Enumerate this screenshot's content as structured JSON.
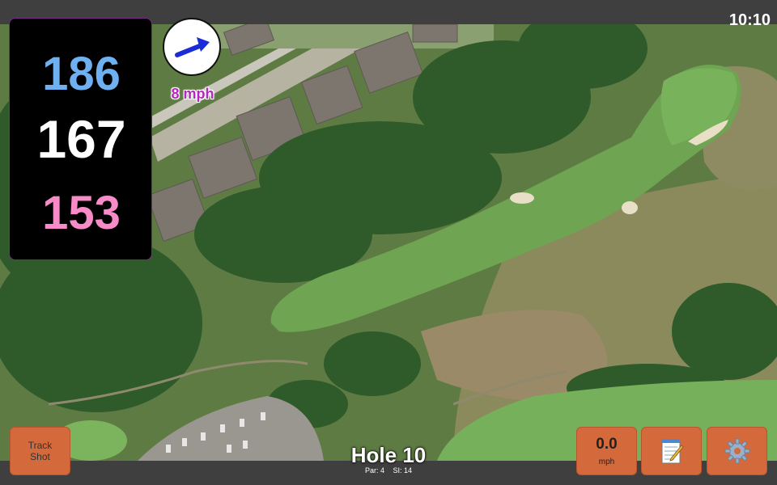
{
  "status": {
    "time": "10:10"
  },
  "distances": {
    "back": "186",
    "middle": "167",
    "front": "153"
  },
  "wind": {
    "speed_label": "8 mph",
    "icon": "wind-arrow-icon"
  },
  "hole": {
    "title": "Hole 10",
    "par_label": "Par: 4",
    "si_label": "SI: 14"
  },
  "buttons": {
    "track_shot_line1": "Track",
    "track_shot_line2": "Shot",
    "speed_value": "0.0",
    "speed_unit": "mph",
    "notes_icon": "notepad-icon",
    "settings_icon": "gear-icon"
  },
  "colors": {
    "back_distance": "#6fb0f0",
    "middle_distance": "#ffffff",
    "front_distance": "#f68bc8",
    "button_accent": "#d4693b",
    "wind_text": "#b427c0"
  }
}
